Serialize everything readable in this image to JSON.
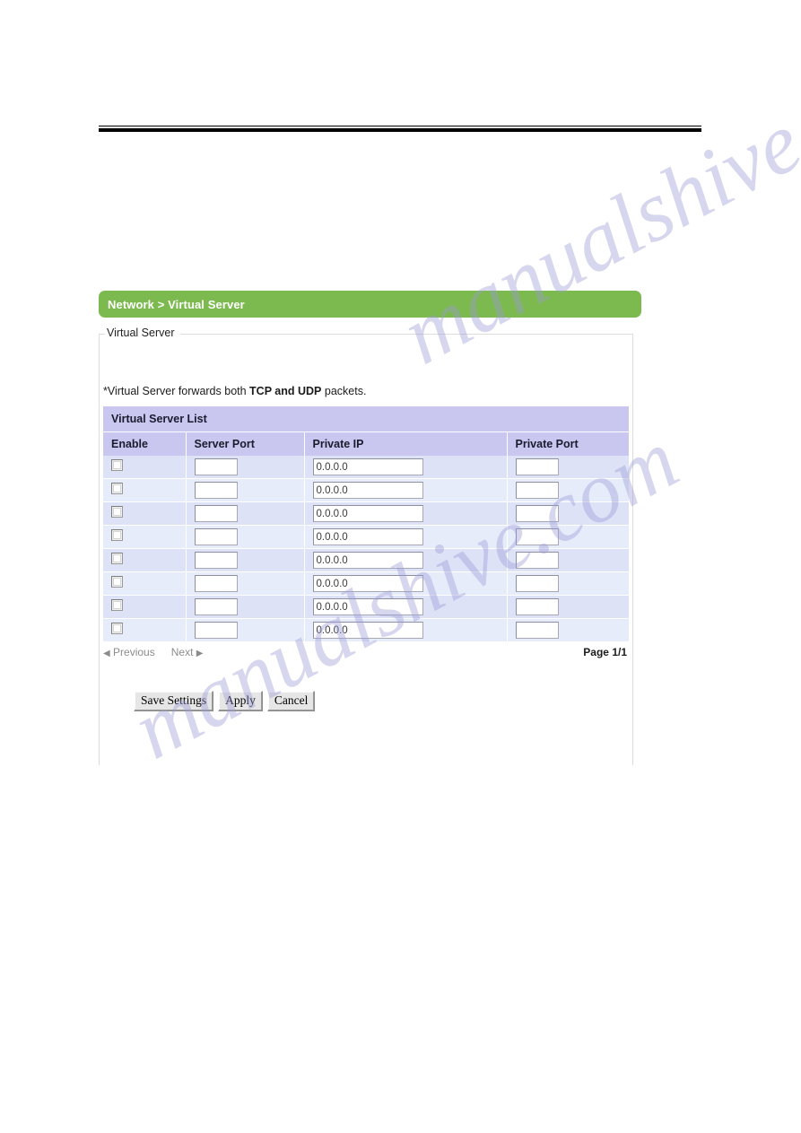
{
  "page": {
    "breadcrumb": "Network > Virtual Server",
    "section_legend": "Virtual Server",
    "note_prefix": "*Virtual Server forwards both ",
    "note_bold": "TCP and UDP",
    "note_suffix": " packets."
  },
  "table": {
    "title": "Virtual Server List",
    "columns": [
      "Enable",
      "Server Port",
      "Private IP",
      "Private Port"
    ],
    "rows": [
      {
        "enable": false,
        "server_port": "",
        "private_ip": "0.0.0.0",
        "private_port": ""
      },
      {
        "enable": false,
        "server_port": "",
        "private_ip": "0.0.0.0",
        "private_port": ""
      },
      {
        "enable": false,
        "server_port": "",
        "private_ip": "0.0.0.0",
        "private_port": ""
      },
      {
        "enable": false,
        "server_port": "",
        "private_ip": "0.0.0.0",
        "private_port": ""
      },
      {
        "enable": false,
        "server_port": "",
        "private_ip": "0.0.0.0",
        "private_port": ""
      },
      {
        "enable": false,
        "server_port": "",
        "private_ip": "0.0.0.0",
        "private_port": ""
      },
      {
        "enable": false,
        "server_port": "",
        "private_ip": "0.0.0.0",
        "private_port": ""
      },
      {
        "enable": false,
        "server_port": "",
        "private_ip": "0.0.0.0",
        "private_port": ""
      }
    ]
  },
  "pager": {
    "previous_label": "Previous",
    "next_label": "Next",
    "previous_arrow": "◀",
    "next_arrow": "▶",
    "page_indicator": "Page 1/1"
  },
  "buttons": {
    "save": "Save Settings",
    "apply": "Apply",
    "cancel": "Cancel"
  },
  "watermark": {
    "line_a": "manualshive.com",
    "line_b": "manualshive.com"
  },
  "colors": {
    "breadcrumb_bar": "#7cba4f",
    "table_header": "#c9c6f0",
    "row_odd": "#dde2f6",
    "row_even": "#e7ecfb"
  }
}
